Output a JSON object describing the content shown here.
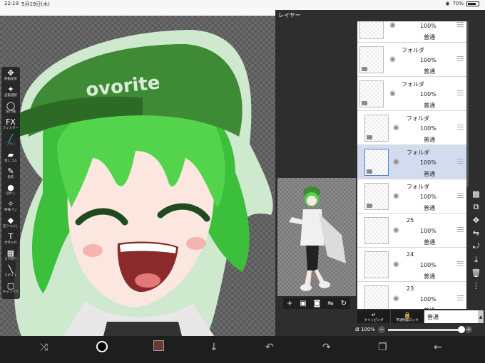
{
  "status": {
    "time": "22:19",
    "date": "5月19日(木)",
    "battery": "70%"
  },
  "tools": [
    {
      "icon": "✥",
      "label": "移動変形",
      "name": "move-transform-tool"
    },
    {
      "icon": "✦",
      "label": "自動選択",
      "name": "auto-select-tool"
    },
    {
      "icon": "◯",
      "label": "投げ縄",
      "name": "lasso-tool"
    },
    {
      "icon": "FX",
      "label": "フィルター",
      "name": "filter-tool"
    },
    {
      "icon": "╱",
      "label": "ブラシ",
      "name": "brush-tool"
    },
    {
      "icon": "▰",
      "label": "消しゴム",
      "name": "eraser-tool"
    },
    {
      "icon": "✎",
      "label": "指先",
      "name": "finger-tool"
    },
    {
      "icon": "●",
      "label": "ぼかし",
      "name": "blur-tool"
    },
    {
      "icon": "✧",
      "label": "特殊ペン",
      "name": "special-pen-tool"
    },
    {
      "icon": "◆",
      "label": "塗りつぶし",
      "name": "fill-tool"
    },
    {
      "icon": "T",
      "label": "文字入れ",
      "name": "text-tool"
    },
    {
      "icon": "▦",
      "label": "コマ割り",
      "name": "frame-divider-tool"
    },
    {
      "icon": "╲",
      "label": "スポイト",
      "name": "eyedropper-tool"
    },
    {
      "icon": "▢",
      "label": "キャンバス",
      "name": "canvas-tool"
    }
  ],
  "panel": {
    "title": "レイヤー"
  },
  "layers": [
    {
      "name": "",
      "opacity": "100%",
      "mode": "普通",
      "folder": false,
      "indent": false,
      "selected": false
    },
    {
      "name": "フォルダ",
      "opacity": "100%",
      "mode": "普通",
      "folder": true,
      "indent": false,
      "selected": false
    },
    {
      "name": "フォルダ",
      "opacity": "100%",
      "mode": "普通",
      "folder": true,
      "indent": false,
      "selected": false
    },
    {
      "name": "フォルダ",
      "opacity": "100%",
      "mode": "普通",
      "folder": true,
      "indent": true,
      "selected": false
    },
    {
      "name": "フォルダ",
      "opacity": "100%",
      "mode": "普通",
      "folder": true,
      "indent": true,
      "selected": true
    },
    {
      "name": "フォルダ",
      "opacity": "100%",
      "mode": "普通",
      "folder": true,
      "indent": true,
      "selected": false
    },
    {
      "name": "25",
      "opacity": "100%",
      "mode": "普通",
      "folder": false,
      "indent": true,
      "selected": false
    },
    {
      "name": "24",
      "opacity": "100%",
      "mode": "普通",
      "folder": false,
      "indent": true,
      "selected": false
    },
    {
      "name": "23",
      "opacity": "100%",
      "mode": "普通",
      "folder": false,
      "indent": true,
      "selected": false
    }
  ],
  "blend": {
    "clipping_label": "クリッピング",
    "lock_label": "不透明度ロック",
    "mode": "普通"
  },
  "alpha": {
    "symbol": "α",
    "value": "100%",
    "minus": "−",
    "plus": "+"
  },
  "colors": {
    "primary": "#000000",
    "secondary": "#6a3a32",
    "accent": "#4fb3ff"
  }
}
